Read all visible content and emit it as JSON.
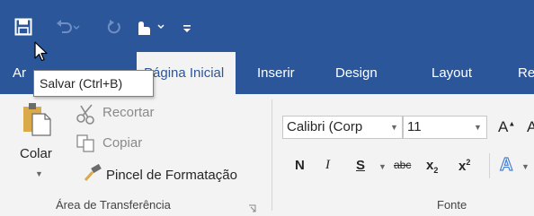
{
  "quick_access": {
    "save_icon": "save-icon",
    "undo_icon": "undo-icon",
    "redo_icon": "redo-icon",
    "touch_mode_icon": "touch-mode-icon",
    "customize_icon": "customize-qat-icon"
  },
  "tabs": {
    "file": "Ar",
    "home": "Página Inicial",
    "insert": "Inserir",
    "design": "Design",
    "layout": "Layout",
    "references": "Re"
  },
  "tooltip": {
    "text": "Salvar (Ctrl+B)"
  },
  "clipboard": {
    "paste_label": "Colar",
    "cut_label": "Recortar",
    "copy_label": "Copiar",
    "format_painter_label": "Pincel de Formatação",
    "group_label": "Área de Transferência"
  },
  "font": {
    "font_name": "Calibri (Corp",
    "font_size": "11",
    "bold": "N",
    "italic": "I",
    "underline": "S",
    "strikethrough": "abc",
    "subscript": "x",
    "subscript_mark": "2",
    "superscript": "x",
    "superscript_mark": "2",
    "grow_font": "A",
    "text_effects": "A",
    "group_label": "Fonte"
  },
  "colors": {
    "accent": "#2b579a",
    "ribbon_bg": "#f3f3f3"
  }
}
